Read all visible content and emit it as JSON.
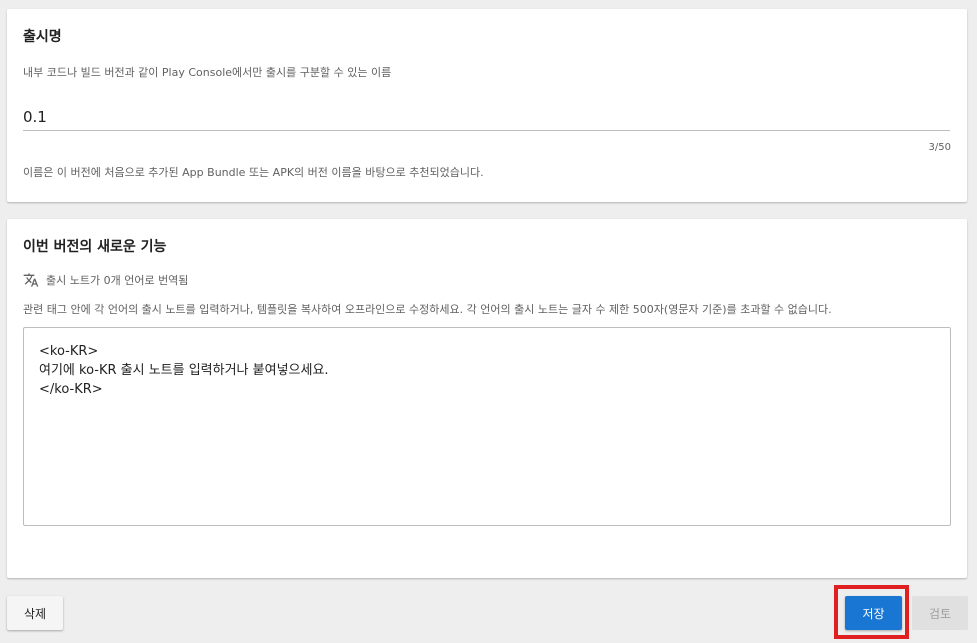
{
  "release_name_card": {
    "title": "출시명",
    "description": "내부 코드나 빌드 버전과 같이 Play Console에서만 출시를 구분할 수 있는 이름",
    "input_value": "0.1",
    "counter": "3/50",
    "hint": "이름은 이 버전에 처음으로 추가된 App Bundle 또는 APK의 버전 이름을 바탕으로 추천되었습니다."
  },
  "release_notes_card": {
    "title": "이번 버전의 새로운 기능",
    "translate_icon": "translate-icon",
    "translate_status": "출시 노트가 0개 언어로 번역됨",
    "instructions": "관련 태그 안에 각 언어의 출시 노트를 입력하거나, 템플릿을 복사하여 오프라인으로 수정하세요. 각 언어의 출시 노트는 글자 수 제한 500자(영문자 기준)를 초과할 수 없습니다.",
    "notes_text": "<ko-KR>\n여기에 ko-KR 출시 노트를 입력하거나 붙여넣으세요.\n</ko-KR>"
  },
  "footer": {
    "delete_label": "삭제",
    "save_label": "저장",
    "review_label": "검토"
  },
  "colors": {
    "primary": "#1976d2",
    "highlight": "#e02020",
    "background": "#eeeeee"
  }
}
